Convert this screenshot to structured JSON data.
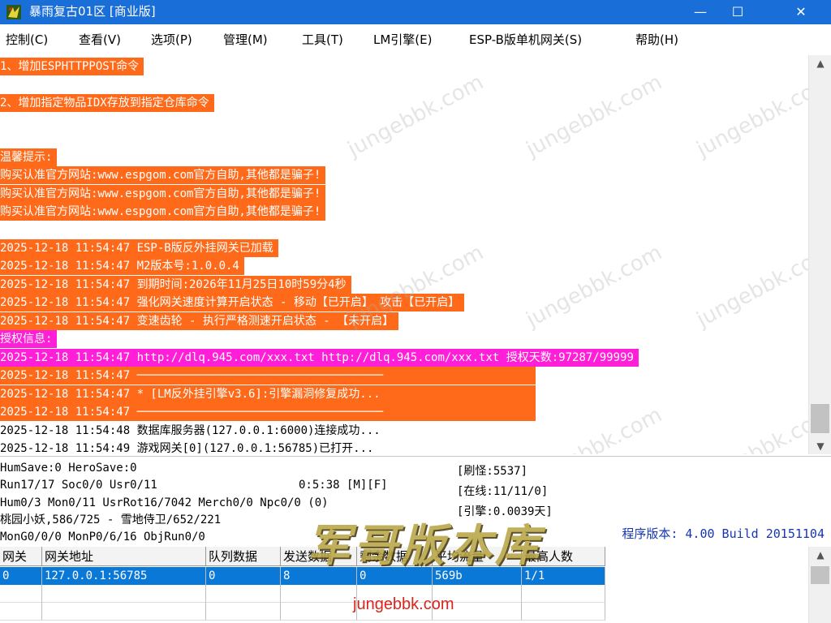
{
  "window": {
    "title": "暴雨复古01区 [商业版]",
    "minimize_glyph": "—",
    "maximize_glyph": "☐",
    "close_glyph": "✕"
  },
  "menu": [
    "控制(C)",
    "查看(V)",
    "选项(P)",
    "管理(M)",
    "工具(T)",
    "LM引擎(E)",
    "ESP-B版单机网关(S)",
    "帮助(H)"
  ],
  "log_lines": [
    {
      "text": "1、增加ESPHTTPPOST命令",
      "style": "orange"
    },
    {
      "text": "2、增加指定物品IDX存放到指定仓库命令",
      "style": "orange"
    },
    {
      "text": "温馨提示:",
      "style": "orange"
    },
    {
      "text": "购买认准官方网站:www.espgom.com官方自助,其他都是骗子!",
      "style": "orange"
    },
    {
      "text": "购买认准官方网站:www.espgom.com官方自助,其他都是骗子!",
      "style": "orange"
    },
    {
      "text": "购买认准官方网站:www.espgom.com官方自助,其他都是骗子!",
      "style": "orange"
    },
    {
      "text": "2025-12-18 11:54:47 ESP-B版反外挂网关已加载",
      "style": "orange"
    },
    {
      "text": "2025-12-18 11:54:47 M2版本号:1.0.0.4",
      "style": "orange"
    },
    {
      "text": "2025-12-18 11:54:47 到期时间:2026年11月25日10时59分4秒",
      "style": "orange"
    },
    {
      "text": "2025-12-18 11:54:47 强化网关速度计算开启状态 - 移动【已开启】 攻击【已开启】",
      "style": "orange"
    },
    {
      "text": "2025-12-18 11:54:47 变速齿轮 - 执行严格测速开启状态 - 【未开启】",
      "style": "orange"
    },
    {
      "text": "授权信息:",
      "style": "magenta"
    },
    {
      "text": "2025-12-18 11:54:47 http://dlq.945.com/xxx.txt http://dlq.945.com/xxx.txt 授权天数:97287/99999",
      "style": "magenta"
    },
    {
      "text": "2025-12-18 11:54:47 ────────────────────────────────────",
      "style": "orange"
    },
    {
      "text": "2025-12-18 11:54:47 * [LM反外挂引擎v3.6]:引擎漏洞修复成功...",
      "style": "orange"
    },
    {
      "text": "2025-12-18 11:54:47 ────────────────────────────────────",
      "style": "orange"
    },
    {
      "text": "2025-12-18 11:54:48 数据库服务器(127.0.0.1:6000)连接成功...",
      "style": "plain"
    },
    {
      "text": "2025-12-18 11:54:49 游戏网关[0](127.0.0.1:56785)已打开...",
      "style": "plain"
    }
  ],
  "status": {
    "line1": "HumSave:0 HeroSave:0",
    "line2": "Run17/17 Soc0/0 Usr0/11",
    "uptime": "0:5:38 [M][F]",
    "line3": "Hum0/3 Mon0/11 UsrRot16/7042 Merch0/0 Npc0/0 (0)",
    "line4": "桃园小妖,586/725 - 雪地侍卫/652/221",
    "line5": "MonG0/0/0 MonP0/6/16 ObjRun0/0",
    "refresh_monster": "[刷怪:5537]",
    "online": "[在线:11/11/0]",
    "engine": "[引擎:0.0039天]",
    "program_version": "程序版本: 4.00 Build 20151104"
  },
  "table": {
    "headers": [
      "网关",
      "网关地址",
      "队列数据",
      "发送数据",
      "剩余数据",
      "平均流量",
      "最高人数"
    ],
    "rows": [
      [
        "0",
        "127.0.0.1:56785",
        "0",
        "8",
        "0",
        "569b",
        "1/1"
      ]
    ]
  },
  "watermark": {
    "site_text": "jungebbk.com",
    "logo_text": "军哥版本库"
  },
  "colors": {
    "titlebar": "#1a6ed8",
    "highlight_orange": "#ff6a1a",
    "highlight_magenta": "#ff1fd8",
    "selected_row": "#0a78d7",
    "version_text": "#1436b4"
  }
}
